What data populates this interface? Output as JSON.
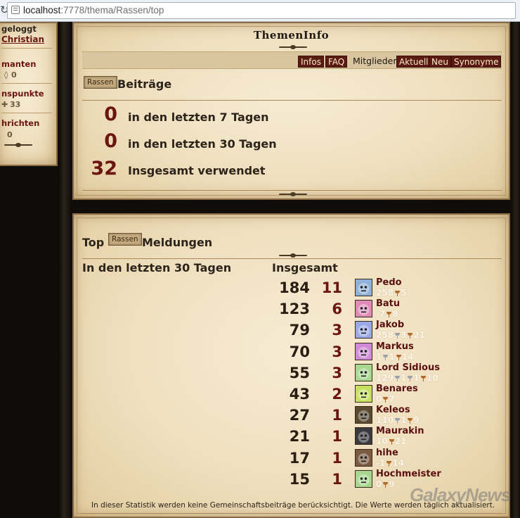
{
  "browser": {
    "url_host": "localhost",
    "url_rest": ":7778/thema/Rassen/top"
  },
  "sidebar": {
    "login_status": "geloggt",
    "username": "Christian",
    "diamonds_label": "manten",
    "diamonds_value": "0",
    "points_label": "nspunkte",
    "points_value": "33",
    "messages_label": "hrichten",
    "messages_value": "0"
  },
  "themen_info": {
    "title": "ThemenInfo",
    "tabs": [
      {
        "label": "Infos"
      },
      {
        "label": "FAQ"
      },
      {
        "label": "Mitglieder"
      },
      {
        "label": "Aktuell"
      },
      {
        "label": "Neu"
      },
      {
        "label": "Synonyme"
      }
    ],
    "active_tab": "Mitglieder",
    "tag": "Rassen",
    "heading": "Beiträge",
    "stats": [
      {
        "value": "0",
        "label": "in den letzten 7 Tagen"
      },
      {
        "value": "0",
        "label": "in den letzten 30 Tagen"
      },
      {
        "value": "32",
        "label": "Insgesamt verwendet"
      }
    ]
  },
  "top_panel": {
    "title_prefix": "Top",
    "tag": "Rassen",
    "title_suffix": "Meldungen",
    "col_recent": "In den letzten 30 Tagen",
    "col_total": "Insgesamt",
    "rows": [
      {
        "total": "184",
        "count": "11",
        "name": "Pedo",
        "stats": [
          [
            "258",
            ""
          ],
          [
            "5",
            "bronze"
          ]
        ],
        "avatar_color": "#8fb0d8"
      },
      {
        "total": "123",
        "count": "6",
        "name": "Batu",
        "stats": [
          [
            "-7",
            ""
          ],
          [
            "8",
            "bronze"
          ]
        ],
        "avatar_color": "#e08ab8"
      },
      {
        "total": "79",
        "count": "3",
        "name": "Jakob",
        "stats": [
          [
            "258",
            ""
          ],
          [
            "3",
            "silver"
          ],
          [
            "21",
            "bronze"
          ]
        ],
        "avatar_color": "#9aa8e8"
      },
      {
        "total": "70",
        "count": "3",
        "name": "Markus",
        "stats": [
          [
            "1",
            ""
          ],
          [
            "1",
            "silver"
          ],
          [
            "14",
            "bronze"
          ]
        ],
        "avatar_color": "#d08ad8"
      },
      {
        "total": "55",
        "count": "3",
        "name": "Lord Sidious",
        "stats": [
          [
            "129",
            ""
          ],
          [
            "1",
            "silver"
          ],
          [
            "1",
            "silver"
          ],
          [
            "10",
            "bronze"
          ]
        ],
        "avatar_color": "#a8d890"
      },
      {
        "total": "43",
        "count": "2",
        "name": "Benares",
        "stats": [
          [
            "0",
            ""
          ],
          [
            "7",
            "bronze"
          ]
        ],
        "avatar_color": "#c8e060"
      },
      {
        "total": "27",
        "count": "1",
        "name": "Keleos",
        "stats": [
          [
            "110",
            ""
          ],
          [
            "1",
            "silver"
          ],
          [
            "9",
            "bronze"
          ]
        ],
        "avatar_color": "#5a4a30"
      },
      {
        "total": "21",
        "count": "1",
        "name": "Maurakin",
        "stats": [
          [
            "10",
            ""
          ],
          [
            "21",
            "bronze"
          ]
        ],
        "avatar_color": "#3a3a40"
      },
      {
        "total": "17",
        "count": "1",
        "name": "hihe",
        "stats": [
          [
            "-1",
            ""
          ],
          [
            "14",
            "bronze"
          ]
        ],
        "avatar_color": "#7a5a40"
      },
      {
        "total": "15",
        "count": "1",
        "name": "Hochmeister",
        "stats": [
          [
            "0",
            ""
          ],
          [
            "9",
            "bronze"
          ]
        ],
        "avatar_color": "#a8d890"
      }
    ],
    "footnote": "In dieser Statistik werden keine Gemeinschaftsbeiträge berücksichtigt. Die Werte werden täglich aktualisiert."
  },
  "watermark": "GalaxyNews"
}
